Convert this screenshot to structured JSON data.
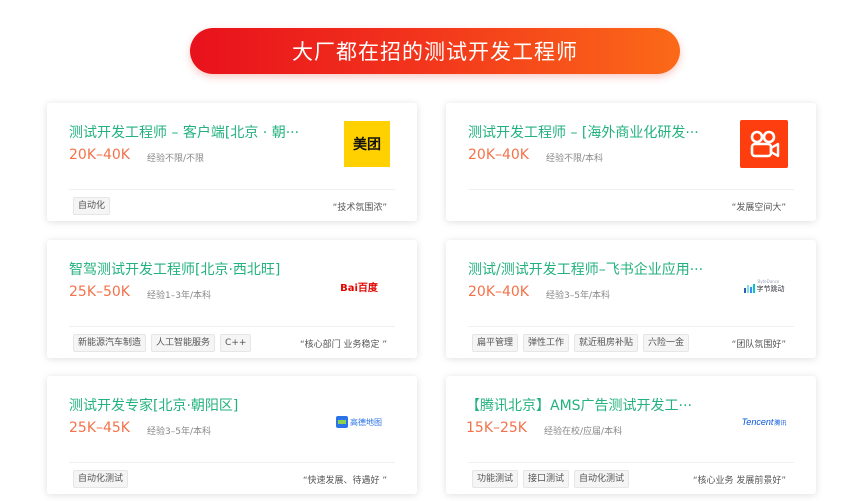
{
  "banner": {
    "title": "大厂都在招的测试开发工程师"
  },
  "jobs": [
    {
      "title": "测试开发工程师 – 客户端[北京 · 朝···",
      "salary": "20K–40K",
      "requirements": "经验不限/不限",
      "company": "美团",
      "logo_icon": "meituan-logo",
      "tags": [
        "自动化"
      ],
      "quote": "“技术氛围浓”"
    },
    {
      "title": "测试开发工程师 – [海外商业化研发···",
      "salary": "20K–40K",
      "requirements": "经验不限/本科",
      "company": "",
      "logo_icon": "kuaishou-logo",
      "tags": [],
      "quote": "“发展空间大”"
    },
    {
      "title": "智驾测试开发工程师[北京·西北旺]",
      "salary": "25K–50K",
      "requirements": "经验1–3年/本科",
      "company": "Bai百度",
      "logo_icon": "baidu-logo",
      "tags": [
        "新能源汽车制造",
        "人工智能服务",
        "C++"
      ],
      "quote": "“核心部门 业务稳定 ”"
    },
    {
      "title": "测试/测试开发工程师–飞书企业应用···",
      "salary": "20K–40K",
      "requirements": "经验3–5年/本科",
      "company": "字节跳动",
      "company_en": "ByteDance",
      "logo_icon": "bytedance-logo",
      "tags": [
        "扁平管理",
        "弹性工作",
        "就近租房补贴",
        "六险一金"
      ],
      "quote": "“团队氛围好”"
    },
    {
      "title": "测试开发专家[北京·朝阳区]",
      "salary": "25K–45K",
      "requirements": "经验3–5年/本科",
      "company": "高德地图",
      "logo_icon": "gaode-map-logo",
      "tags": [
        "自动化测试"
      ],
      "quote": "“快速发展、待遇好 ”"
    },
    {
      "title": "【腾讯北京】AMS广告测试开发工···",
      "salary": "15K–25K",
      "requirements": "经验在校/应届/本科",
      "company": "Tencent",
      "company_cn": "腾讯",
      "logo_icon": "tencent-logo",
      "tags": [
        "功能测试",
        "接口测试",
        "自动化测试"
      ],
      "quote": "“核心业务 发展前景好”"
    }
  ],
  "colors": {
    "banner_start": "#e8111c",
    "banner_end": "#fb6a18",
    "title_green": "#23b27f",
    "salary_orange": "#f3724a",
    "meituan_yellow": "#ffd100",
    "kuaishou_orange": "#fe3e0e"
  }
}
